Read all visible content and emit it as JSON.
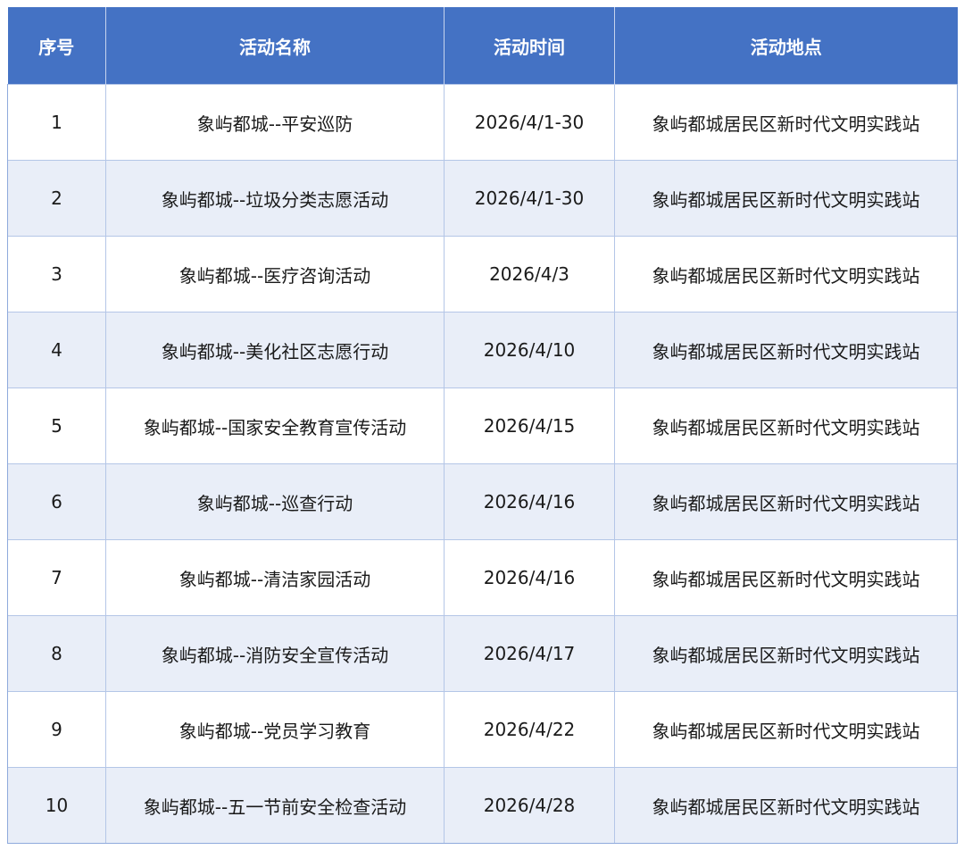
{
  "headers": [
    "序号",
    "活动名称",
    "活动时间",
    "活动地点"
  ],
  "rows": [
    {
      "no": "1",
      "name": "象屿都城--平安巡防",
      "time": "2026/4/1-30",
      "place": "象屿都城居民区新时代文明实践站"
    },
    {
      "no": "2",
      "name": "象屿都城--垃圾分类志愿活动",
      "time": "2026/4/1-30",
      "place": "象屿都城居民区新时代文明实践站"
    },
    {
      "no": "3",
      "name": "象屿都城--医疗咨询活动",
      "time": "2026/4/3",
      "place": "象屿都城居民区新时代文明实践站"
    },
    {
      "no": "4",
      "name": "象屿都城--美化社区志愿行动",
      "time": "2026/4/10",
      "place": "象屿都城居民区新时代文明实践站"
    },
    {
      "no": "5",
      "name": "象屿都城--国家安全教育宣传活动",
      "time": "2026/4/15",
      "place": "象屿都城居民区新时代文明实践站"
    },
    {
      "no": "6",
      "name": "象屿都城--巡查行动",
      "time": "2026/4/16",
      "place": "象屿都城居民区新时代文明实践站"
    },
    {
      "no": "7",
      "name": "象屿都城--清洁家园活动",
      "time": "2026/4/16",
      "place": "象屿都城居民区新时代文明实践站"
    },
    {
      "no": "8",
      "name": "象屿都城--消防安全宣传活动",
      "time": "2026/4/17",
      "place": "象屿都城居民区新时代文明实践站"
    },
    {
      "no": "9",
      "name": "象屿都城--党员学习教育",
      "time": "2026/4/22",
      "place": "象屿都城居民区新时代文明实践站"
    },
    {
      "no": "10",
      "name": "象屿都城--五一节前安全检查活动",
      "time": "2026/4/28",
      "place": "象屿都城居民区新时代文明实践站"
    }
  ],
  "colors": {
    "header_bg": "#4472c4",
    "header_text": "#ffffff",
    "row_alt_bg": "#e9eef8",
    "grid_line": "#b4c6e7"
  }
}
